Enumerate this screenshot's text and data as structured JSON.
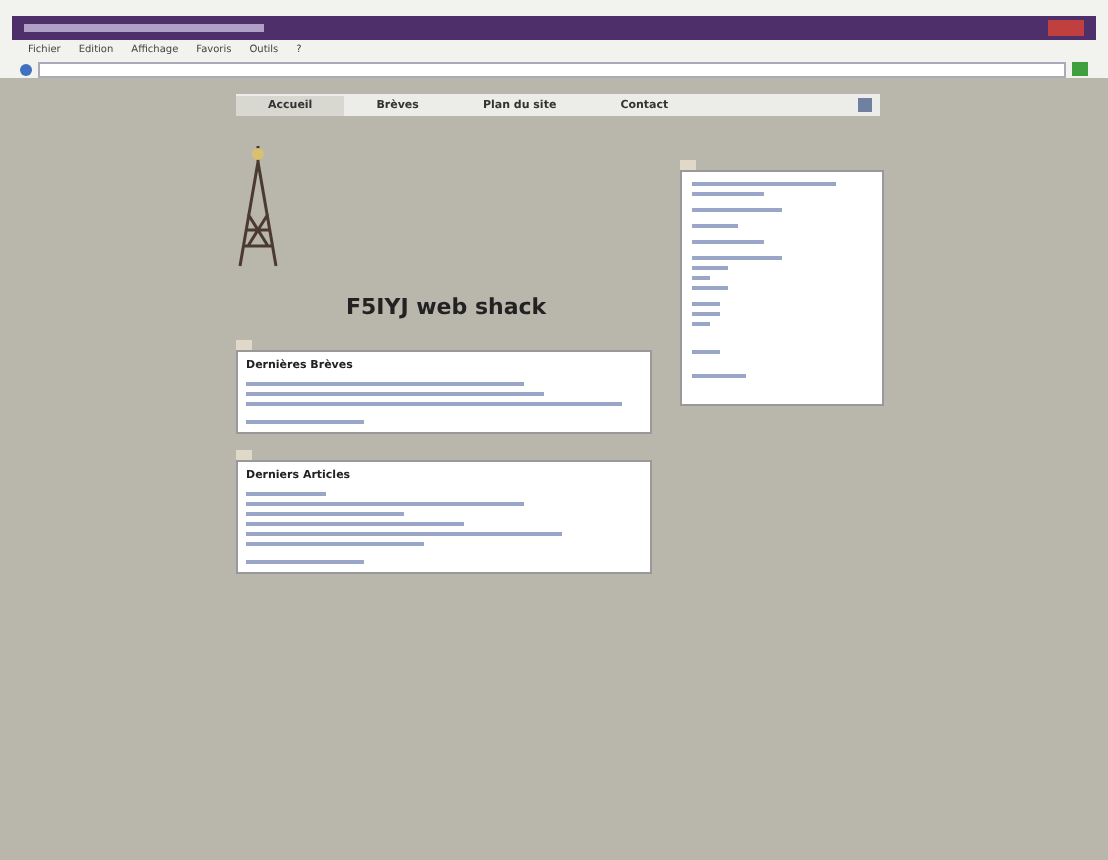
{
  "browser": {
    "menu": [
      "Fichier",
      "Edition",
      "Affichage",
      "Favoris",
      "Outils",
      "?"
    ]
  },
  "nav": [
    {
      "label": "Accueil",
      "selected": true
    },
    {
      "label": "Brèves",
      "selected": false
    },
    {
      "label": "Plan du site",
      "selected": false
    },
    {
      "label": "Contact",
      "selected": false
    }
  ],
  "site_title": "F5IYJ web shack",
  "sections": [
    {
      "title": "Dernières Brèves"
    },
    {
      "title": "Derniers Articles"
    }
  ]
}
